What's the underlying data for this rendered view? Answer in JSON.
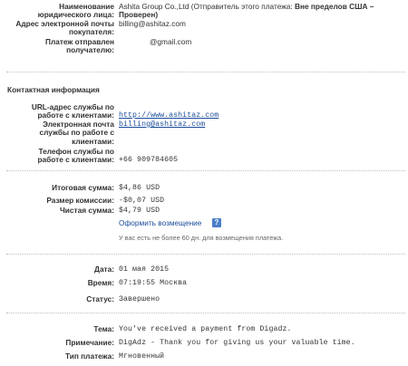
{
  "merchant": {
    "legal_name_label_1": "Наименование",
    "legal_name_label_2": "юридического лица:",
    "legal_name_value": "Ashita Group Co.,Ltd (Отправитель этого платежа: ",
    "legal_name_bold_1": "Вне пределов США –",
    "legal_name_bold_2": "Проверен)",
    "email_label_1": "Адрес электронной почты",
    "email_label_2": "покупателя:",
    "email_value": "billing@ashitaz.com",
    "sent_to_label_1": "Платеж отправлен",
    "sent_to_label_2": "получателю:",
    "sent_to_value": "@gmail.com"
  },
  "contact": {
    "section_title": "Контактная информация",
    "service_url_label_1": "URL-адрес службы по",
    "service_url_label_2": "работе с клиентами:",
    "service_url_value": "http://www.ashitaz.com",
    "service_email_label_1": "Электронная почта",
    "service_email_label_2": "службы по работе с",
    "service_email_label_3": "клиентами:",
    "service_email_value": "billing@ashitaz.com",
    "phone_label_1": "Телефон службы по",
    "phone_label_2": "работе с клиентами:",
    "phone_value": "+66 909784605"
  },
  "amounts": {
    "total_label": "Итоговая сумма:",
    "total_value": "$4,86 USD",
    "fee_label": "Размер комиссии:",
    "fee_value": "-$0,07 USD",
    "net_label": "Чистая сумма:",
    "net_value": "$4,79 USD",
    "refund_link": "Оформить возмещение",
    "help_icon_glyph": "?",
    "refund_note": "У вас есть не более 60 дн. для возмещения платежа."
  },
  "details": {
    "date_label": "Дата:",
    "date_value": "01 мая 2015",
    "time_label": "Время:",
    "time_value": "07:19:55 Москва",
    "status_label": "Статус:",
    "status_value": "Завершено"
  },
  "message": {
    "subject_label": "Тема:",
    "subject_value": "You've received a payment from Digadz.",
    "note_label": "Примечание:",
    "note_value": "DigAdz - Thank you for giving us your valuable time.",
    "type_label": "Тип платежа:",
    "type_value": "Мгновенный"
  },
  "colors": {
    "link": "#1a4c9a",
    "help_icon": "#4a7fc7",
    "divider": "#bfbfbf"
  }
}
